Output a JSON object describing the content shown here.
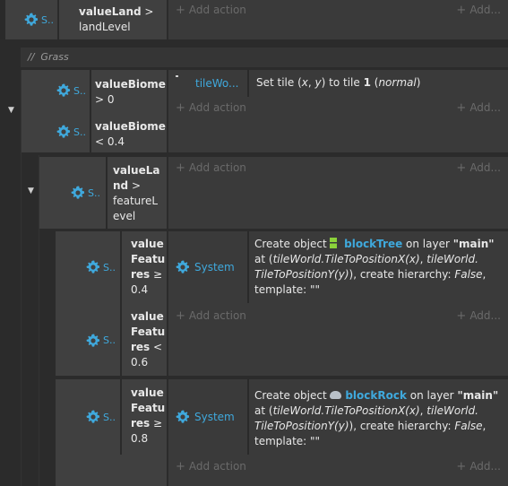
{
  "top_event": {
    "cond_short": "S..",
    "cond_bold": "valueLand",
    "cond_op": " >",
    "cond_line2": "landLevel",
    "add_action": "Add action",
    "add_right": "Add..."
  },
  "comment": {
    "slashes": "//",
    "text": "Grass"
  },
  "grass_event": {
    "cond1_short": "S..",
    "cond1_bold": "valueBiome",
    "cond1_line2": "> 0",
    "cond2_short": "S..",
    "cond2_bold": "valueBiome",
    "cond2_line2": "< 0.4",
    "action_object": "tileWo...",
    "action_text_pre": "Set tile (",
    "action_x": "x",
    "action_mid": ", ",
    "action_y": "y",
    "action_text_post": ") to tile ",
    "action_tile": "1",
    "action_paren": "normal",
    "add_action": "Add action",
    "add_right": "Add..."
  },
  "feature_event": {
    "cond_short": "S..",
    "cond_l1": "valueLa",
    "cond_l2": "nd",
    "cond_l3": "featureL",
    "cond_l4": "evel",
    "cond_op": " >",
    "add_action": "Add action",
    "add_right": "Add..."
  },
  "tree_event": {
    "cond1_short": "S..",
    "cond1_l1": "value",
    "cond1_l2": "Featu",
    "cond1_l3": "res",
    "cond1_op": " ≥",
    "cond1_l4": "0.4",
    "cond2_short": "S..",
    "cond2_l1": "value",
    "cond2_l2": "Featu",
    "cond2_l3": "res",
    "cond2_op": " <",
    "cond2_l4": "0.6",
    "action_object": "System",
    "create_pre": "Create object ",
    "create_name": "blockTree",
    "create_layer_pre": " on layer ",
    "create_layer": "\"main\"",
    "at_pre": "at (",
    "at_x": "tileWorld.TileToPositionX(x)",
    "at_comma": ", ",
    "at_y1": "tileWorld.",
    "at_y2": "TileToPositionY(y)",
    "at_post": "), create hierarchy: ",
    "hierarchy": "False",
    "template_label": "template: ",
    "template_value": "\"\"",
    "add_action": "Add action",
    "add_right": "Add..."
  },
  "rock_event": {
    "cond_short": "S..",
    "cond_l1": "value",
    "cond_l2": "Featu",
    "cond_l3": "res",
    "cond_op": " ≥",
    "cond_l4": "0.8",
    "action_object": "System",
    "create_pre": "Create object ",
    "create_name": "blockRock",
    "create_layer_pre": " on layer ",
    "create_layer": "\"main\"",
    "at_pre": "at (",
    "at_x": "tileWorld.TileToPositionX(x)",
    "at_comma": ", ",
    "at_y1": "tileWorld.",
    "at_y2": "TileToPositionY(y)",
    "at_post": "), create hierarchy: ",
    "hierarchy": "False",
    "template_label": "template: ",
    "template_value": "\"\"",
    "add_action": "Add action",
    "add_right": "Add..."
  },
  "colors": {
    "accent": "#3fa9dd",
    "tree_green": "#8bd13a",
    "add_text": "#6a6a6a"
  },
  "icons": {
    "condition": "gear-icon",
    "collapse": "chevron-down-icon",
    "tree": "tree-sprite-icon",
    "rock": "rock-sprite-icon"
  }
}
